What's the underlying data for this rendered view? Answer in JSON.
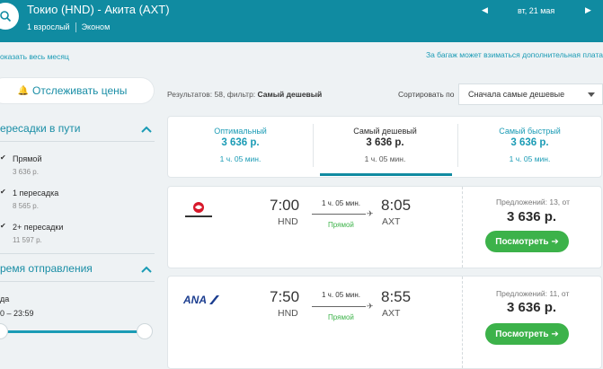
{
  "header": {
    "route": "Токио (HND) - Акита (AXT)",
    "passengers": "1 взрослый",
    "cabin": "Эконом",
    "date": "вт, 21 мая",
    "prev_arrow": "◀",
    "next_arrow": "▶"
  },
  "links": {
    "show_month": "оказать весь месяц",
    "baggage": "За багаж может взиматься дополнительная плата"
  },
  "sidebar": {
    "track_prices": "Отслеживать цены",
    "stops_title": "ересадки в пути",
    "stops": [
      {
        "label": "Прямой",
        "price": "3 636 р."
      },
      {
        "label": "1 пересадка",
        "price": "8 565 р."
      },
      {
        "label": "2+ пересадки",
        "price": "11 597 р."
      }
    ],
    "departure_title": "ремя отправления",
    "departure_label": "да",
    "departure_range": "0 – 23:59"
  },
  "toolbar": {
    "results_prefix": "Результатов: 58, фильтр: ",
    "results_filter": "Самый дешевый",
    "sort_label": "Сортировать по",
    "sort_value": "Сначала самые дешевые"
  },
  "tabs": [
    {
      "title": "Оптимальный",
      "price": "3 636 р.",
      "duration": "1 ч. 05 мин."
    },
    {
      "title": "Самый дешевый",
      "price": "3 636 р.",
      "duration": "1 ч. 05 мин."
    },
    {
      "title": "Самый быстрый",
      "price": "3 636 р.",
      "duration": "1 ч. 05 мин."
    }
  ],
  "flights": [
    {
      "airline": "JAL",
      "dep_time": "7:00",
      "arr_time": "8:05",
      "dep_code": "HND",
      "arr_code": "AXT",
      "duration": "1 ч. 05 мин.",
      "stops": "Прямой",
      "offers": "Предложений: 13, от",
      "price": "3 636 р.",
      "button": "Посмотреть ➔"
    },
    {
      "airline": "ANA",
      "dep_time": "7:50",
      "arr_time": "8:55",
      "dep_code": "HND",
      "arr_code": "AXT",
      "duration": "1 ч. 05 мин.",
      "stops": "Прямой",
      "offers": "Предложений: 11, от",
      "price": "3 636 р.",
      "button": "Посмотреть ➔"
    }
  ],
  "colors": {
    "header_bg": "#108ba1",
    "accent": "#1a9bb5",
    "cta_green": "#3cb24a",
    "jal_red": "#d7182a",
    "ana_blue": "#1b3d8f"
  }
}
